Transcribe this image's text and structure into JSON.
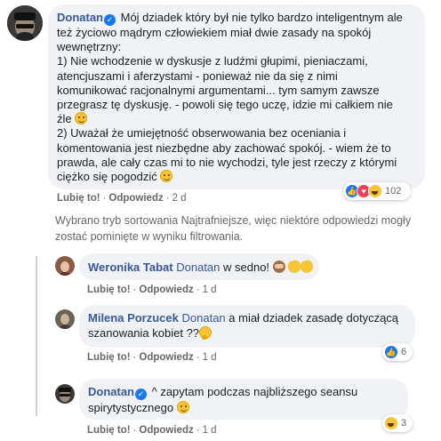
{
  "colors": {
    "name": "#385898",
    "meta": "#65676b",
    "bubble": "#f0f2f5",
    "like": "#1877f2",
    "love": "#f33e58",
    "haha": "#f7c433"
  },
  "comment1": {
    "author": "Donatan",
    "lines": [
      "Mój dziadek który był nie tylko bardzo inteligentnym ale",
      "też życiowo mądrym człowiekiem miał dwie zasady na spokój",
      "wewnętrzny:",
      "1) Nie wchodzenie w dyskusje z ludźmi głupimi, pieniaczami,",
      "atencjuszami i aferzystami - ponieważ nie da się z nimi",
      "komunikować racjonalnymi argumentami... tym samym zawsze",
      "przegrasz tę dyskusję. - powoli się tego uczę, idzie mi całkiem nie",
      "źle",
      "2) Uważał że umiejętność obserwowania bez oceniania i",
      "komentowania jest niezbędne aby zachować spokój. - wiem że to",
      "prawda, ale cały czas mi to nie wychodzi, tyle jest rzeczy z którymi",
      "ciężko się pogodzić"
    ],
    "like": "Lubię to!",
    "reply": "Odpowiedz",
    "time": "2 d",
    "reaction_count": "102"
  },
  "notice": "Wybrano tryb sortowania Najtrafniejsze, więc niektóre odpowiedzi mogły zostać pominięte w wyniku filtrowania.",
  "reply1": {
    "author": "Weronika Tabat",
    "mention": "Donatan",
    "text": " w sedno! ",
    "like": "Lubię to!",
    "reply": "Odpowiedz",
    "time": "1 d"
  },
  "reply2": {
    "author": "Milena Porzucek",
    "mention": "Donatan",
    "text1": " a miał dziadek zasadę dotyczącą",
    "text2": "szanowania kobiet ??",
    "like": "Lubię to!",
    "reply": "Odpowiedz",
    "time": "1 d",
    "reaction_count": "6"
  },
  "reply3": {
    "author": "Donatan",
    "text1": " ^ zapytam podczas najbliższego seansu",
    "text2": "spirytystycznego ",
    "like": "Lubię to!",
    "reply": "Odpowiedz",
    "time": "1 d",
    "reaction_count": "3"
  }
}
